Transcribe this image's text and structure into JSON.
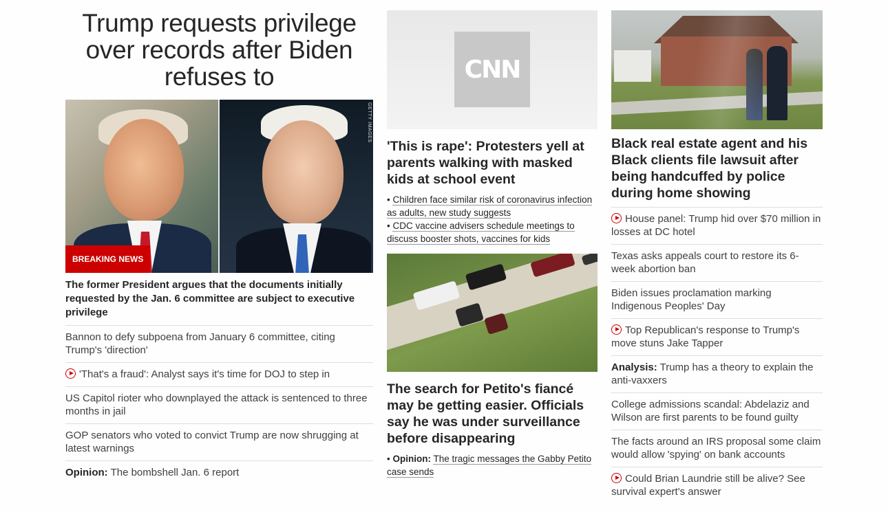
{
  "left": {
    "hero_title": "Trump requests privilege over records after Biden refuses to",
    "hero_credit": "GETTY IMAGES",
    "breaking_label": "BREAKING NEWS",
    "hero_desc": "The former President argues that the documents initially requested by the Jan. 6 committee are subject to executive privilege",
    "items": [
      {
        "text": "Bannon to defy subpoena from January 6 committee, citing Trump's 'direction'",
        "video": false,
        "prefix": ""
      },
      {
        "text": "'That's a fraud': Analyst says it's time for DOJ to step in",
        "video": true,
        "prefix": ""
      },
      {
        "text": "US Capitol rioter who downplayed the attack is sentenced to three months in jail",
        "video": false,
        "prefix": ""
      },
      {
        "text": "GOP senators who voted to convict Trump are now shrugging at latest warnings",
        "video": false,
        "prefix": ""
      },
      {
        "text": "The bombshell Jan. 6 report",
        "video": false,
        "prefix": "Opinion:"
      }
    ]
  },
  "middle": {
    "logo_text": "CNN",
    "headline1": "'This is rape': Protesters yell at parents walking with masked kids at school event",
    "sublinks1": [
      "Children face similar risk of coronavirus infection as adults, new study suggests",
      "CDC vaccine advisers schedule meetings to discuss booster shots, vaccines for kids"
    ],
    "headline2": "The search for Petito's fiancé may be getting easier. Officials say he was under surveillance before disappearing",
    "sublink2_prefix": "Opinion:",
    "sublink2_text": "The tragic messages the Gabby Petito case sends"
  },
  "right": {
    "headline": "Black real estate agent and his Black clients file lawsuit after being handcuffed by police during home showing",
    "items": [
      {
        "text": "House panel: Trump hid over $70 million in losses at DC hotel",
        "video": true,
        "prefix": ""
      },
      {
        "text": "Texas asks appeals court to restore its 6-week abortion ban",
        "video": false,
        "prefix": ""
      },
      {
        "text": "Biden issues proclamation marking Indigenous Peoples' Day",
        "video": false,
        "prefix": ""
      },
      {
        "text": "Top Republican's response to Trump's move stuns Jake Tapper",
        "video": true,
        "prefix": ""
      },
      {
        "text": "Trump has a theory to explain the anti-vaxxers",
        "video": false,
        "prefix": "Analysis:"
      },
      {
        "text": "College admissions scandal: Abdelaziz and Wilson are first parents to be found guilty",
        "video": false,
        "prefix": ""
      },
      {
        "text": "The facts around an IRS proposal some claim would allow 'spying' on bank accounts",
        "video": false,
        "prefix": ""
      },
      {
        "text": "Could Brian Laundrie still be alive? See survival expert's answer",
        "video": true,
        "prefix": ""
      }
    ]
  }
}
